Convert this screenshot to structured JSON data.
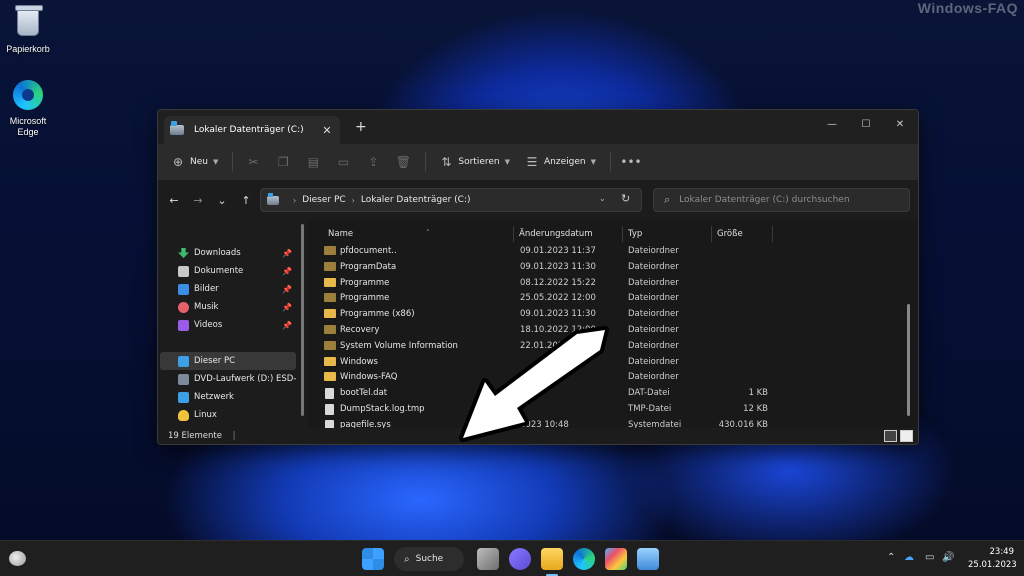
{
  "watermark": "Windows-FAQ",
  "desktop": {
    "icons": [
      {
        "label": "Papierkorb",
        "icon": "recycle-bin-icon"
      },
      {
        "label": "Microsoft Edge",
        "icon": "edge-icon"
      }
    ]
  },
  "window": {
    "tab_title": "Lokaler Datenträger (C:)",
    "toolbar": {
      "new_label": "Neu",
      "sort_label": "Sortieren",
      "view_label": "Anzeigen"
    },
    "address": {
      "crumbs": [
        "Dieser PC",
        "Lokaler Datenträger (C:)"
      ]
    },
    "search": {
      "placeholder": "Lokaler Datenträger (C:) durchsuchen"
    },
    "sidebar": {
      "items": [
        {
          "label": "Downloads",
          "icon": "download-icon",
          "color": "#3fb96b",
          "pinned": true
        },
        {
          "label": "Dokumente",
          "icon": "document-icon",
          "color": "#c8c8c8",
          "pinned": true
        },
        {
          "label": "Bilder",
          "icon": "image-icon",
          "color": "#3a8ee6",
          "pinned": true
        },
        {
          "label": "Musik",
          "icon": "music-icon",
          "color": "#e8616a",
          "pinned": true
        },
        {
          "label": "Videos",
          "icon": "video-icon",
          "color": "#9a5be8",
          "pinned": true
        },
        {
          "label": "Dieser PC",
          "icon": "pc-icon",
          "color": "#3ba0e6",
          "selected": true
        },
        {
          "label": "DVD-Laufwerk (D:) ESD-ISO",
          "icon": "dvd-drive-icon",
          "color": "#7d8a99"
        },
        {
          "label": "Netzwerk",
          "icon": "network-icon",
          "color": "#3ba0e6"
        },
        {
          "label": "Linux",
          "icon": "linux-icon",
          "color": "#f0c33c"
        }
      ]
    },
    "columns": {
      "name": "Name",
      "date": "Änderungsdatum",
      "type": "Typ",
      "size": "Größe"
    },
    "files": [
      {
        "name": "pfdocument..",
        "date": "09.01.2023 11:37",
        "type": "Dateiordner",
        "size": "",
        "kind": "folder-dim"
      },
      {
        "name": "ProgramData",
        "date": "09.01.2023 11:30",
        "type": "Dateiordner",
        "size": "",
        "kind": "folder-dim"
      },
      {
        "name": "Programme",
        "date": "08.12.2022 15:22",
        "type": "Dateiordner",
        "size": "",
        "kind": "folder"
      },
      {
        "name": "Programme",
        "date": "25.05.2022 12:00",
        "type": "Dateiordner",
        "size": "",
        "kind": "folder-dim"
      },
      {
        "name": "Programme (x86)",
        "date": "09.01.2023 11:30",
        "type": "Dateiordner",
        "size": "",
        "kind": "folder"
      },
      {
        "name": "Recovery",
        "date": "18.10.2022 12:00",
        "type": "Dateiordner",
        "size": "",
        "kind": "folder-dim"
      },
      {
        "name": "System Volume Information",
        "date": "22.01.2023 1",
        "type": "Dateiordner",
        "size": "",
        "kind": "folder-dim"
      },
      {
        "name": "Windows",
        "date": "",
        "type": "Dateiordner",
        "size": "",
        "kind": "folder"
      },
      {
        "name": "Windows-FAQ",
        "date": "",
        "type": "Dateiordner",
        "size": "",
        "kind": "folder"
      },
      {
        "name": "bootTel.dat",
        "date": "16",
        "type": "DAT-Datei",
        "size": "1 KB",
        "kind": "file"
      },
      {
        "name": "DumpStack.log.tmp",
        "date": "",
        "type": "TMP-Datei",
        "size": "12 KB",
        "kind": "file"
      },
      {
        "name": "pagefile.sys",
        "date": "2023 10:48",
        "type": "Systemdatei",
        "size": "430.016 KB",
        "kind": "file"
      }
    ],
    "status": "19 Elemente"
  },
  "taskbar": {
    "search_label": "Suche",
    "time": "23:49",
    "date": "25.01.2023"
  }
}
